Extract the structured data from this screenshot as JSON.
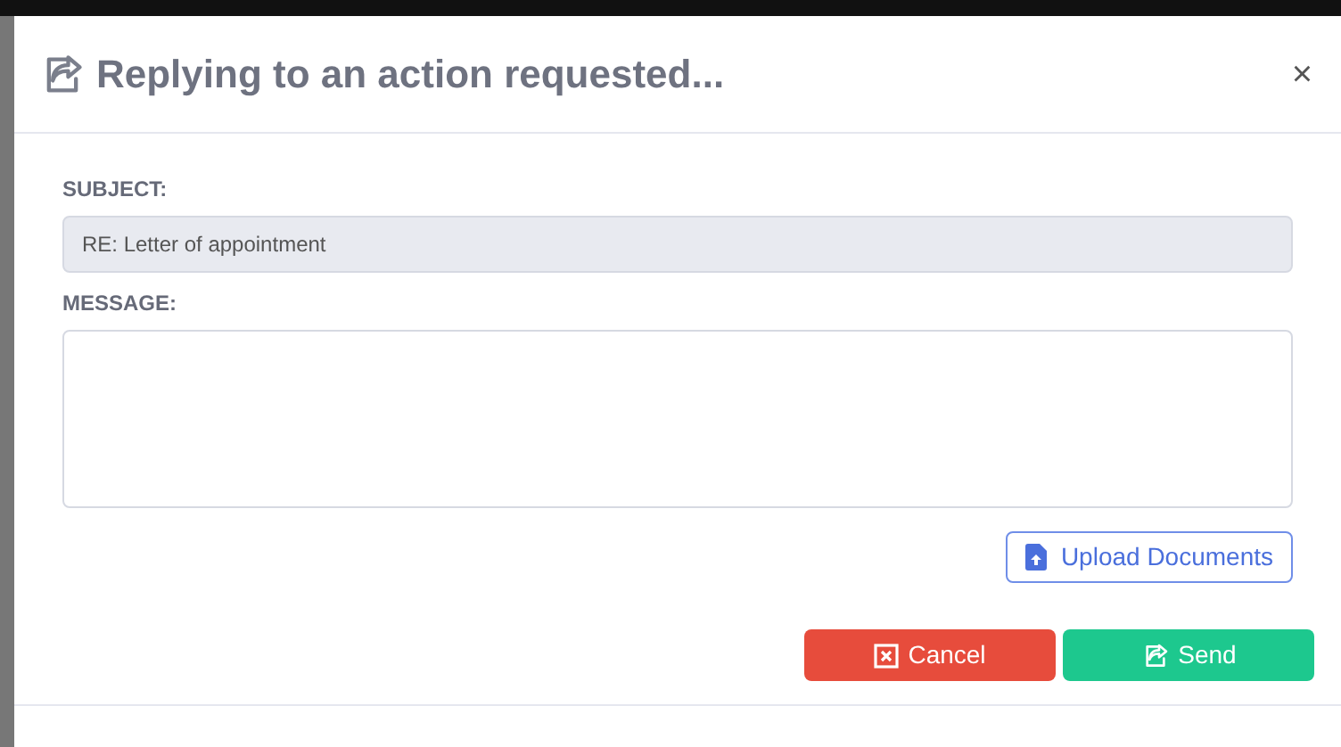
{
  "dialog": {
    "title": "Replying to an action requested...",
    "close": "×"
  },
  "subject": {
    "label": "SUBJECT:",
    "value": "RE: Letter of appointment",
    "disabled": true
  },
  "message": {
    "label": "MESSAGE:"
  },
  "upload_button": "Upload Documents",
  "buttons": [
    {
      "kind": "cancel",
      "label": "Cancel"
    },
    {
      "kind": "send",
      "label": "Send"
    }
  ]
}
